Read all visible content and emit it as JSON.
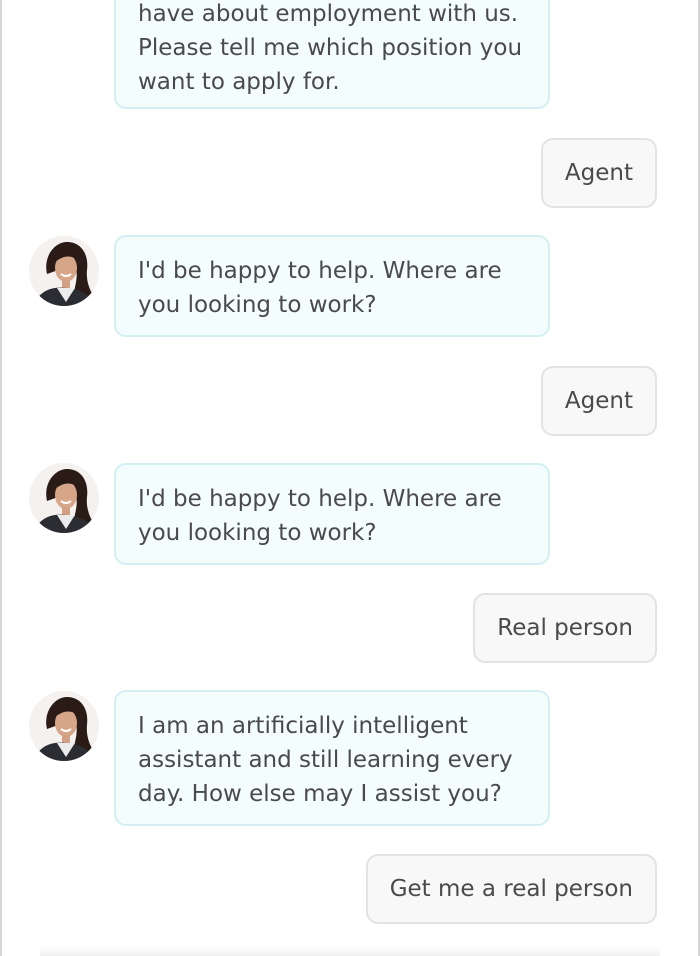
{
  "chat": {
    "messages": [
      {
        "sender": "bot",
        "text": "have about employment with us. Please tell me which position you want to apply for."
      },
      {
        "sender": "user",
        "text": "Agent"
      },
      {
        "sender": "bot",
        "text": "I'd be happy to help. Where are you looking to work?"
      },
      {
        "sender": "user",
        "text": "Agent"
      },
      {
        "sender": "bot",
        "text": "I'd be happy to help. Where are you looking to work?"
      },
      {
        "sender": "user",
        "text": "Real person"
      },
      {
        "sender": "bot",
        "text": "I am an artificially intelligent assistant and still learning every day. How else may I assist you?"
      },
      {
        "sender": "user",
        "text": "Get me a real person"
      }
    ]
  },
  "colors": {
    "bot_bubble_bg": "#f3fdfe",
    "bot_bubble_border": "#d3eff1",
    "user_bubble_bg": "#f8f8f8",
    "user_bubble_border": "#e3e3e3",
    "text": "#4a4a4a"
  },
  "icons": {
    "bot_avatar": "assistant-avatar-icon"
  }
}
